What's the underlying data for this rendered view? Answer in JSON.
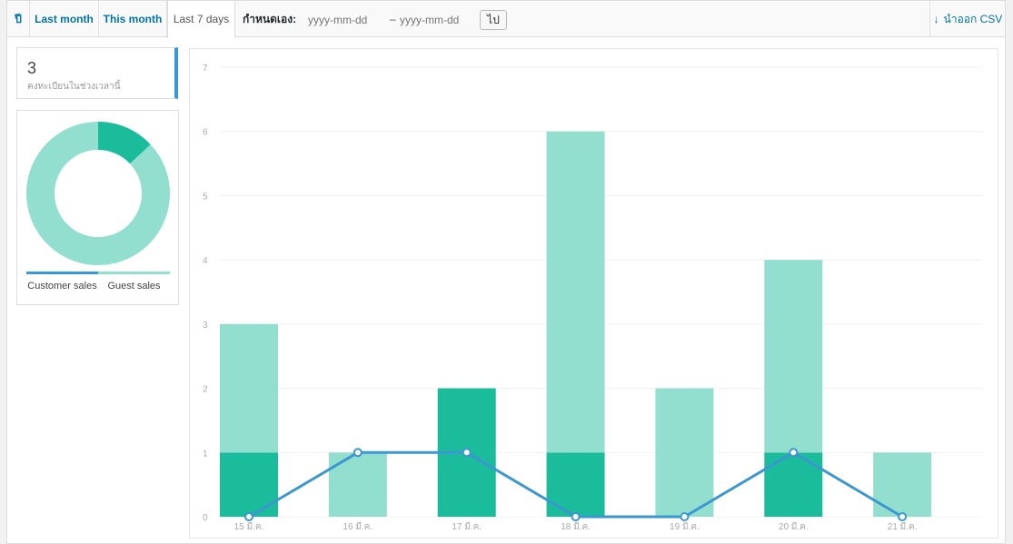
{
  "rangebar": {
    "tabs": [
      {
        "label": "ปี",
        "active": false
      },
      {
        "label": "Last month",
        "active": false
      },
      {
        "label": "This month",
        "active": false
      },
      {
        "label": "Last 7 days",
        "active": true
      }
    ],
    "custom_label": "กำหนดเอง:",
    "start_placeholder": "yyyy-mm-dd",
    "end_placeholder": "yyyy-mm-dd",
    "dash": "–",
    "go_label": "ไป",
    "export_label": "นำออก CSV"
  },
  "summary": {
    "value": "3",
    "label": "คงทะเบียนในช่วงเวลานี้"
  },
  "pie": {
    "legend": [
      "Customer sales",
      "Guest sales"
    ],
    "colors": [
      "#1abc9c",
      "#93dfcf"
    ],
    "legend_colors": [
      "#3498db",
      "#93dfcf"
    ],
    "values": [
      3,
      20
    ]
  },
  "chart_data": {
    "type": "bar",
    "categories": [
      "15 มี.ค.",
      "16 มี.ค.",
      "17 มี.ค.",
      "18 มี.ค.",
      "19 มี.ค.",
      "20 มี.ค.",
      "21 มี.ค."
    ],
    "series": [
      {
        "name": "Customer sales",
        "values": [
          1,
          0,
          2,
          1,
          0,
          1,
          0
        ],
        "color": "#1abc9c",
        "stacked": true
      },
      {
        "name": "Guest sales",
        "values": [
          2,
          1,
          0,
          5,
          2,
          3,
          1
        ],
        "color": "#93dfcf",
        "stacked": true
      },
      {
        "type": "line",
        "values": [
          0,
          1,
          1,
          0,
          0,
          1,
          0
        ],
        "color": "#3c96d0"
      }
    ],
    "ylim": [
      0,
      7
    ],
    "yticks": [
      0,
      1,
      2,
      3,
      4,
      5,
      6,
      7
    ],
    "grid": true
  }
}
